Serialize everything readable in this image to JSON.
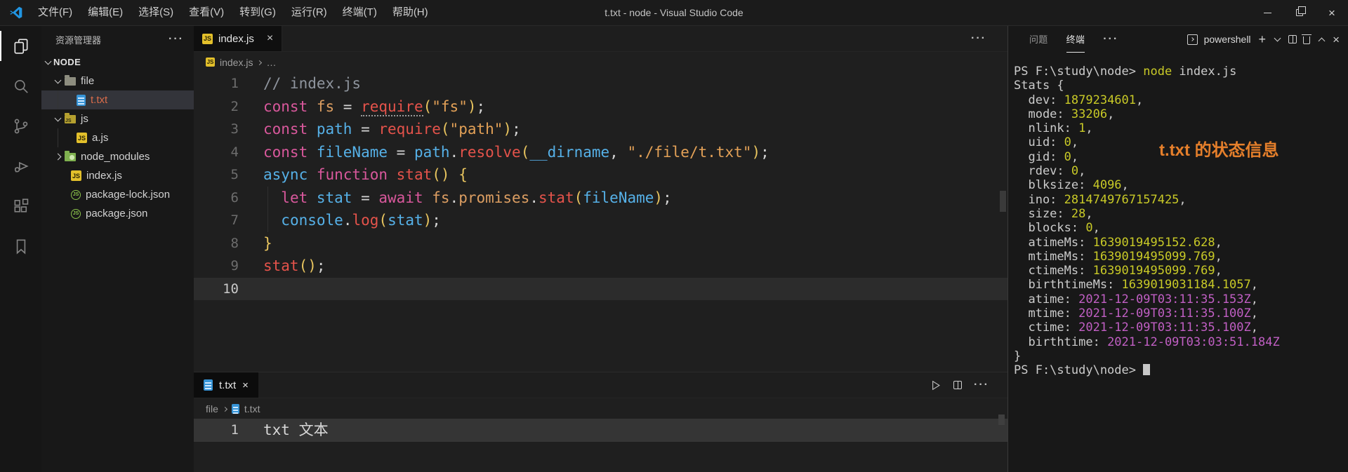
{
  "titlebar": {
    "title": "t.txt - node - Visual Studio Code",
    "menus": [
      "文件(F)",
      "编辑(E)",
      "选择(S)",
      "查看(V)",
      "转到(G)",
      "运行(R)",
      "终端(T)",
      "帮助(H)"
    ]
  },
  "icons": {
    "more": "···",
    "close": "×",
    "plus": "+"
  },
  "activity_bar": [
    "explorer",
    "search",
    "source-control",
    "run-debug",
    "extensions",
    "bookmarks"
  ],
  "sidebar": {
    "header": "资源管理器",
    "tree": [
      {
        "label": "NODE",
        "type": "root",
        "chevron": "down"
      },
      {
        "label": "file",
        "type": "folder",
        "icon": "f-gray",
        "chevron": "down",
        "level": 1
      },
      {
        "label": "t.txt",
        "type": "file",
        "icon": "txt",
        "level": 2,
        "selected": true,
        "guide": true,
        "color": "#d96c4a"
      },
      {
        "label": "js",
        "type": "folder",
        "icon": "f-js",
        "chevron": "down",
        "level": 1
      },
      {
        "label": "a.js",
        "type": "file",
        "icon": "js",
        "level": 2,
        "guide": true
      },
      {
        "label": "node_modules",
        "type": "folder",
        "icon": "f-green",
        "chevron": "right",
        "level": 1
      },
      {
        "label": "index.js",
        "type": "file",
        "icon": "js",
        "level": 1
      },
      {
        "label": "package-lock.json",
        "type": "file",
        "icon": "node",
        "level": 1
      },
      {
        "label": "package.json",
        "type": "file",
        "icon": "node",
        "level": 1
      }
    ]
  },
  "editor": {
    "tab_label": "index.js",
    "breadcrumb_file": "index.js",
    "breadcrumb_more": "…",
    "current_line": 10,
    "lines": [
      {
        "num": 1,
        "tokens": [
          [
            "cm",
            "// index.js"
          ]
        ]
      },
      {
        "num": 2,
        "tokens": [
          [
            "kw",
            "const "
          ],
          [
            "prop",
            "fs "
          ],
          [
            "op",
            "= "
          ],
          [
            "fnu",
            "require"
          ],
          [
            "br",
            "("
          ],
          [
            "str",
            "\"fs\""
          ],
          [
            "br",
            ")"
          ],
          [
            "op",
            ";"
          ]
        ]
      },
      {
        "num": 3,
        "tokens": [
          [
            "kw",
            "const "
          ],
          [
            "var",
            "path "
          ],
          [
            "op",
            "= "
          ],
          [
            "fn",
            "require"
          ],
          [
            "br",
            "("
          ],
          [
            "str",
            "\"path\""
          ],
          [
            "br",
            ")"
          ],
          [
            "op",
            ";"
          ]
        ]
      },
      {
        "num": 4,
        "tokens": [
          [
            "kw",
            "const "
          ],
          [
            "var",
            "fileName "
          ],
          [
            "op",
            "= "
          ],
          [
            "var",
            "path"
          ],
          [
            "op",
            "."
          ],
          [
            "fn",
            "resolve"
          ],
          [
            "br",
            "("
          ],
          [
            "var",
            "__dirname"
          ],
          [
            "op",
            ", "
          ],
          [
            "str",
            "\"./file/t.txt\""
          ],
          [
            "br",
            ")"
          ],
          [
            "op",
            ";"
          ]
        ]
      },
      {
        "num": 5,
        "tokens": [
          [
            "var",
            "async "
          ],
          [
            "kw",
            "function "
          ],
          [
            "fn",
            "stat"
          ],
          [
            "br",
            "()"
          ],
          [
            "op",
            " "
          ],
          [
            "br",
            "{"
          ]
        ]
      },
      {
        "num": 6,
        "tokens": [
          [
            "op",
            "  "
          ],
          [
            "kw",
            "let "
          ],
          [
            "var",
            "stat "
          ],
          [
            "op",
            "= "
          ],
          [
            "kw",
            "await "
          ],
          [
            "prop",
            "fs"
          ],
          [
            "op",
            "."
          ],
          [
            "prop",
            "promises"
          ],
          [
            "op",
            "."
          ],
          [
            "fn",
            "stat"
          ],
          [
            "br",
            "("
          ],
          [
            "var",
            "fileName"
          ],
          [
            "br",
            ")"
          ],
          [
            "op",
            ";"
          ]
        ]
      },
      {
        "num": 7,
        "tokens": [
          [
            "op",
            "  "
          ],
          [
            "var",
            "console"
          ],
          [
            "op",
            "."
          ],
          [
            "fn",
            "log"
          ],
          [
            "br",
            "("
          ],
          [
            "var",
            "stat"
          ],
          [
            "br",
            ")"
          ],
          [
            "op",
            ";"
          ]
        ]
      },
      {
        "num": 8,
        "tokens": [
          [
            "br",
            "}"
          ]
        ]
      },
      {
        "num": 9,
        "tokens": [
          [
            "fn",
            "stat"
          ],
          [
            "br",
            "()"
          ],
          [
            "op",
            ";"
          ]
        ]
      },
      {
        "num": 10,
        "tokens": []
      }
    ]
  },
  "bottom_editor": {
    "tab_label": "t.txt",
    "breadcrumb_folder": "file",
    "breadcrumb_file": "t.txt",
    "current_line": 1,
    "lines": [
      {
        "num": 1,
        "tokens": [
          [
            "w",
            "txt 文本"
          ]
        ]
      }
    ]
  },
  "panel": {
    "problems_tab": "问题",
    "terminal_tab": "终端",
    "shell": "powershell",
    "annotation": "t.txt 的状态信息",
    "terminal_lines": [
      [
        [
          "t",
          "PS F:\\study\\node> "
        ],
        [
          "y",
          "node"
        ],
        [
          "t",
          " index.js"
        ]
      ],
      [
        [
          "t",
          "Stats {"
        ]
      ],
      [
        [
          "t",
          "  dev: "
        ],
        [
          "y",
          "1879234601"
        ],
        [
          "t",
          ","
        ]
      ],
      [
        [
          "t",
          "  mode: "
        ],
        [
          "y",
          "33206"
        ],
        [
          "t",
          ","
        ]
      ],
      [
        [
          "t",
          "  nlink: "
        ],
        [
          "y",
          "1"
        ],
        [
          "t",
          ","
        ]
      ],
      [
        [
          "t",
          "  uid: "
        ],
        [
          "y",
          "0"
        ],
        [
          "t",
          ","
        ]
      ],
      [
        [
          "t",
          "  gid: "
        ],
        [
          "y",
          "0"
        ],
        [
          "t",
          ","
        ]
      ],
      [
        [
          "t",
          "  rdev: "
        ],
        [
          "y",
          "0"
        ],
        [
          "t",
          ","
        ]
      ],
      [
        [
          "t",
          "  blksize: "
        ],
        [
          "y",
          "4096"
        ],
        [
          "t",
          ","
        ]
      ],
      [
        [
          "t",
          "  ino: "
        ],
        [
          "y",
          "2814749767157425"
        ],
        [
          "t",
          ","
        ]
      ],
      [
        [
          "t",
          "  size: "
        ],
        [
          "y",
          "28"
        ],
        [
          "t",
          ","
        ]
      ],
      [
        [
          "t",
          "  blocks: "
        ],
        [
          "y",
          "0"
        ],
        [
          "t",
          ","
        ]
      ],
      [
        [
          "t",
          "  atimeMs: "
        ],
        [
          "y",
          "1639019495152.628"
        ],
        [
          "t",
          ","
        ]
      ],
      [
        [
          "t",
          "  mtimeMs: "
        ],
        [
          "y",
          "1639019495099.769"
        ],
        [
          "t",
          ","
        ]
      ],
      [
        [
          "t",
          "  ctimeMs: "
        ],
        [
          "y",
          "1639019495099.769"
        ],
        [
          "t",
          ","
        ]
      ],
      [
        [
          "t",
          "  birthtimeMs: "
        ],
        [
          "y",
          "1639019031184.1057"
        ],
        [
          "t",
          ","
        ]
      ],
      [
        [
          "t",
          "  atime: "
        ],
        [
          "m",
          "2021-12-09T03:11:35.153Z"
        ],
        [
          "t",
          ","
        ]
      ],
      [
        [
          "t",
          "  mtime: "
        ],
        [
          "m",
          "2021-12-09T03:11:35.100Z"
        ],
        [
          "t",
          ","
        ]
      ],
      [
        [
          "t",
          "  ctime: "
        ],
        [
          "m",
          "2021-12-09T03:11:35.100Z"
        ],
        [
          "t",
          ","
        ]
      ],
      [
        [
          "t",
          "  birthtime: "
        ],
        [
          "m",
          "2021-12-09T03:03:51.184Z"
        ]
      ],
      [
        [
          "t",
          "}"
        ]
      ],
      [
        [
          "t",
          "PS F:\\study\\node> "
        ],
        [
          "cursor",
          ""
        ]
      ]
    ]
  },
  "colors": {
    "annotation_orange": "#e57f2b",
    "txt_file_orange": "#d96c4a",
    "keyword_pink": "#d9589c",
    "variable_blue": "#56b1e8",
    "function_red": "#e5534b",
    "string_orange": "#e3a157",
    "bracket_gold": "#e9c55f",
    "terminal_yellow": "#c9ca27",
    "terminal_magenta": "#c15fc4",
    "file_icon_blue": "#3794d6",
    "js_icon_yellow": "#e3c02b",
    "node_icon_green": "#8ac24a"
  }
}
